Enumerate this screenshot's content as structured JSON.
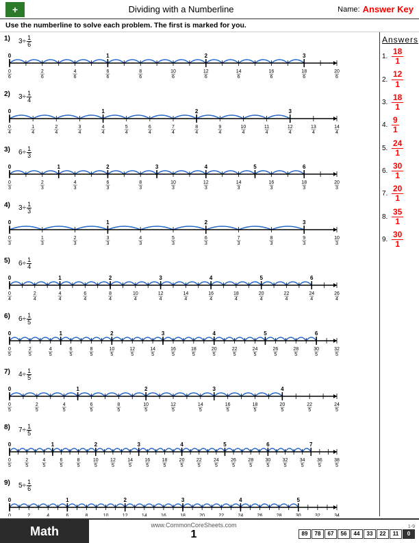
{
  "header": {
    "title": "Dividing with a Numberline",
    "name_label": "Name:",
    "answer_key": "Answer Key",
    "logo_symbol": "+"
  },
  "instructions": "Use the numberline to solve each problem. The first is marked for you.",
  "answers_title": "Answers",
  "answers": [
    {
      "num": "1.",
      "numerator": "18",
      "denominator": "1"
    },
    {
      "num": "2.",
      "numerator": "12",
      "denominator": "1"
    },
    {
      "num": "3.",
      "numerator": "18",
      "denominator": "1"
    },
    {
      "num": "4.",
      "numerator": "9",
      "denominator": "1"
    },
    {
      "num": "5.",
      "numerator": "24",
      "denominator": "1"
    },
    {
      "num": "6.",
      "numerator": "30",
      "denominator": "1"
    },
    {
      "num": "7.",
      "numerator": "20",
      "denominator": "1"
    },
    {
      "num": "8.",
      "numerator": "35",
      "denominator": "1"
    },
    {
      "num": "9.",
      "numerator": "30",
      "denominator": "1"
    }
  ],
  "problems": [
    {
      "num": "1)",
      "whole": "3",
      "frac_num": "1",
      "frac_den": "6",
      "arcs": 18,
      "max_val": 3,
      "denominator": 6,
      "max_label": 20,
      "tick_count": 21
    },
    {
      "num": "2)",
      "whole": "3",
      "frac_num": "1",
      "frac_den": "4",
      "arcs": 12,
      "max_val": 3,
      "denominator": 4,
      "max_label": 14,
      "tick_count": 15
    },
    {
      "num": "3)",
      "whole": "6",
      "frac_num": "1",
      "frac_den": "3",
      "arcs": 18,
      "max_val": 7,
      "denominator": 3,
      "max_label": 20,
      "tick_count": 21
    },
    {
      "num": "4)",
      "whole": "3",
      "frac_num": "1",
      "frac_den": "3",
      "arcs": 9,
      "max_val": 3,
      "denominator": 3,
      "max_label": 10,
      "tick_count": 11
    },
    {
      "num": "5)",
      "whole": "6",
      "frac_num": "1",
      "frac_den": "4",
      "arcs": 24,
      "max_val": 6,
      "denominator": 4,
      "max_label": 26,
      "tick_count": 27
    },
    {
      "num": "6)",
      "whole": "6",
      "frac_num": "1",
      "frac_den": "5",
      "arcs": 30,
      "max_val": 6,
      "denominator": 5,
      "max_label": 32,
      "tick_count": 33
    },
    {
      "num": "7)",
      "whole": "4",
      "frac_num": "1",
      "frac_den": "5",
      "arcs": 20,
      "max_val": 5,
      "denominator": 5,
      "max_label": 24,
      "tick_count": 25
    },
    {
      "num": "8)",
      "whole": "7",
      "frac_num": "1",
      "frac_den": "5",
      "arcs": 35,
      "max_val": 7,
      "denominator": 5,
      "max_label": 38,
      "tick_count": 39
    },
    {
      "num": "9)",
      "whole": "5",
      "frac_num": "1",
      "frac_den": "6",
      "arcs": 30,
      "max_val": 5,
      "denominator": 6,
      "max_label": 34,
      "tick_count": 35
    }
  ],
  "footer": {
    "math_label": "Math",
    "website": "www.CommonCoreSheets.com",
    "page_num": "1",
    "score_label": "1-9",
    "scores": [
      "89",
      "78",
      "67",
      "56",
      "44",
      "33",
      "22",
      "11",
      "0"
    ]
  }
}
